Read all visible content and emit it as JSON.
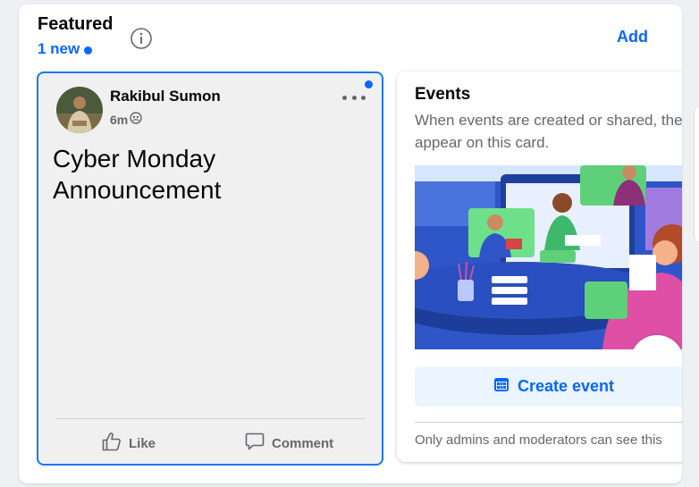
{
  "header": {
    "title": "Featured",
    "new_count": "1 new",
    "add_label": "Add"
  },
  "post": {
    "author": "Rakibul Sumon",
    "time": "6m",
    "audience_icon": "group-audience-icon",
    "text": "Cyber Monday Announcement",
    "like_label": "Like",
    "comment_label": "Comment"
  },
  "events": {
    "title": "Events",
    "description": "When events are created or shared, they appear on this card.",
    "create_label": "Create event",
    "note": "Only admins and moderators can see this"
  },
  "colors": {
    "accent": "#0866ff",
    "card_border": "#1877f2",
    "card_bg": "#f0f0f0",
    "button_bg": "#ebf5ff"
  }
}
